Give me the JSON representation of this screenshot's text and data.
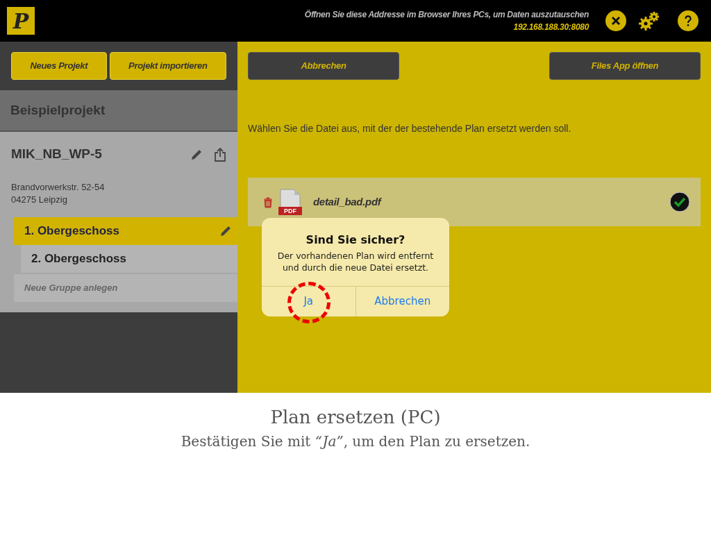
{
  "header": {
    "logo": "P",
    "message": "Öffnen Sie diese Addresse im Browser Ihres PCs, um Daten auszutauschen",
    "address": "192.168.188.30:8080"
  },
  "sidebar": {
    "buttons": [
      "Neues Projekt",
      "Projekt importieren"
    ],
    "section_title": "Beispielprojekt",
    "project": {
      "name": "MIK_NB_WP-5",
      "address_lines": [
        "Brandvorwerkstr. 52-54",
        "04275 Leipzig"
      ]
    },
    "floors": [
      {
        "label": "1. Obergeschoss",
        "selected": true
      },
      {
        "label": "2. Obergeschoss",
        "selected": false
      }
    ],
    "new_group": "Neue Gruppe anlegen"
  },
  "main": {
    "cancel_button": "Abbrechen",
    "files_button": "Files App öffnen",
    "instruction": "Wählen Sie die Datei aus, mit der der bestehende Plan ersetzt werden soll.",
    "file": {
      "name": "detail_bad.pdf",
      "icon_label": "PDF",
      "checked": true
    }
  },
  "dialog": {
    "title": "Sind Sie sicher?",
    "message": "Der vorhandenen Plan wird entfernt und durch die neue Datei ersetzt.",
    "buttons": [
      {
        "label": "Ja",
        "highlighted": true
      },
      {
        "label": "Abbrechen",
        "highlighted": false
      }
    ]
  },
  "caption": {
    "title": "Plan ersetzen (PC)",
    "text": "Bestätigen Sie mit *“Ja”*, um den Plan zu ersetzen."
  }
}
